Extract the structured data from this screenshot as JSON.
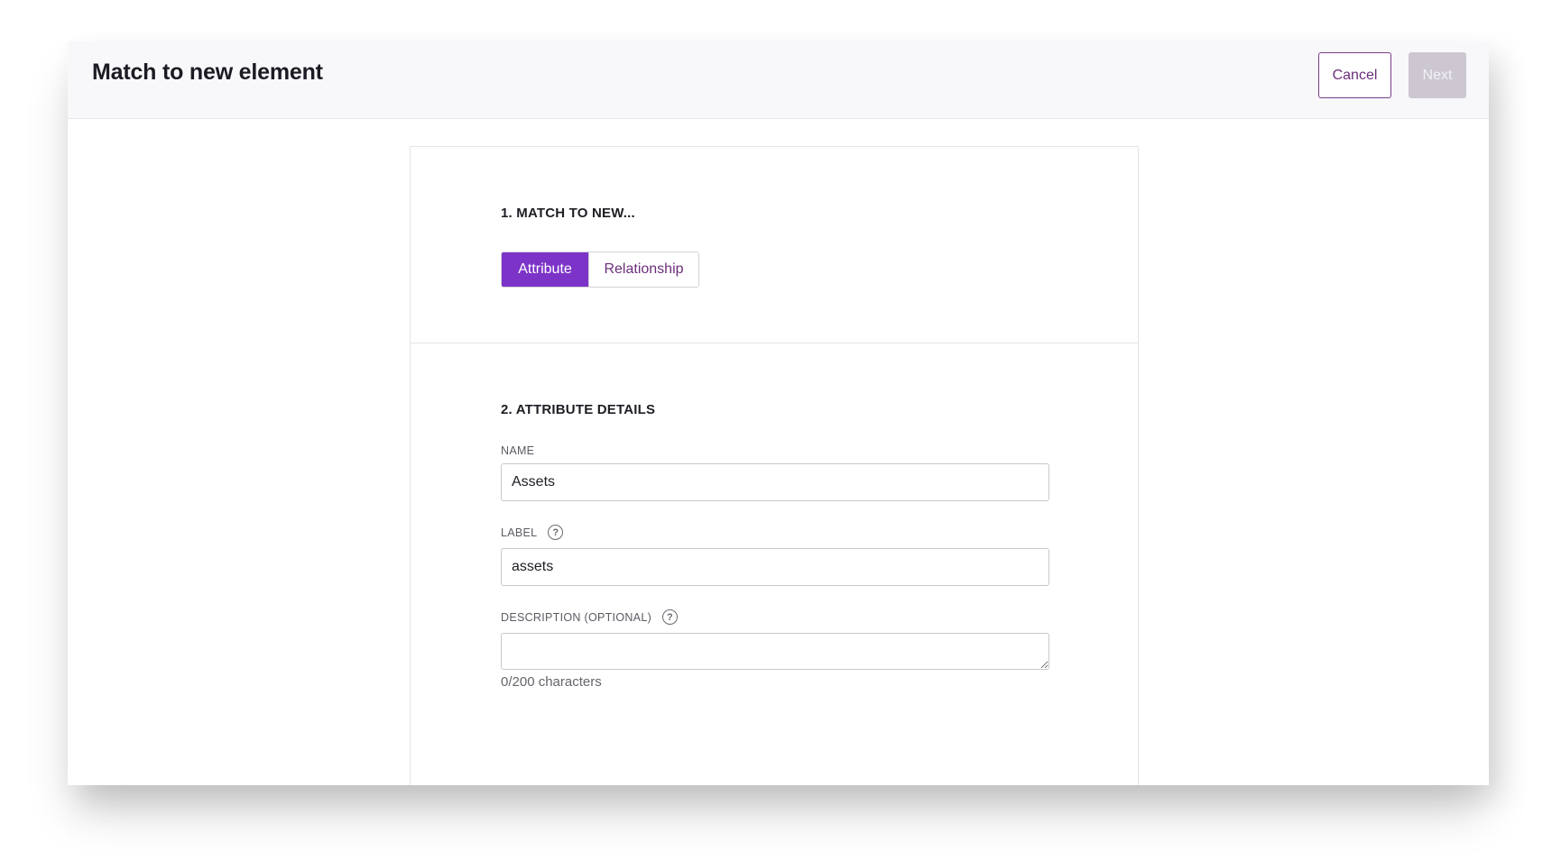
{
  "header": {
    "title": "Match to new element",
    "cancel_label": "Cancel",
    "next_label": "Next"
  },
  "step1": {
    "title": "1. MATCH TO NEW...",
    "options": [
      "Attribute",
      "Relationship"
    ],
    "selected": "Attribute"
  },
  "step2": {
    "title": "2. ATTRIBUTE DETAILS",
    "name": {
      "label": "NAME",
      "value": "Assets"
    },
    "label_field": {
      "label": "LABEL",
      "value": "assets"
    },
    "description": {
      "label": "DESCRIPTION (OPTIONAL)",
      "value": "",
      "char_count": "0/200 characters"
    }
  },
  "colors": {
    "accent": "#7c34c8",
    "cancel_border": "#7a3c88",
    "next_disabled": "#ccc7d1"
  },
  "icons": [
    "help-circle-icon"
  ]
}
